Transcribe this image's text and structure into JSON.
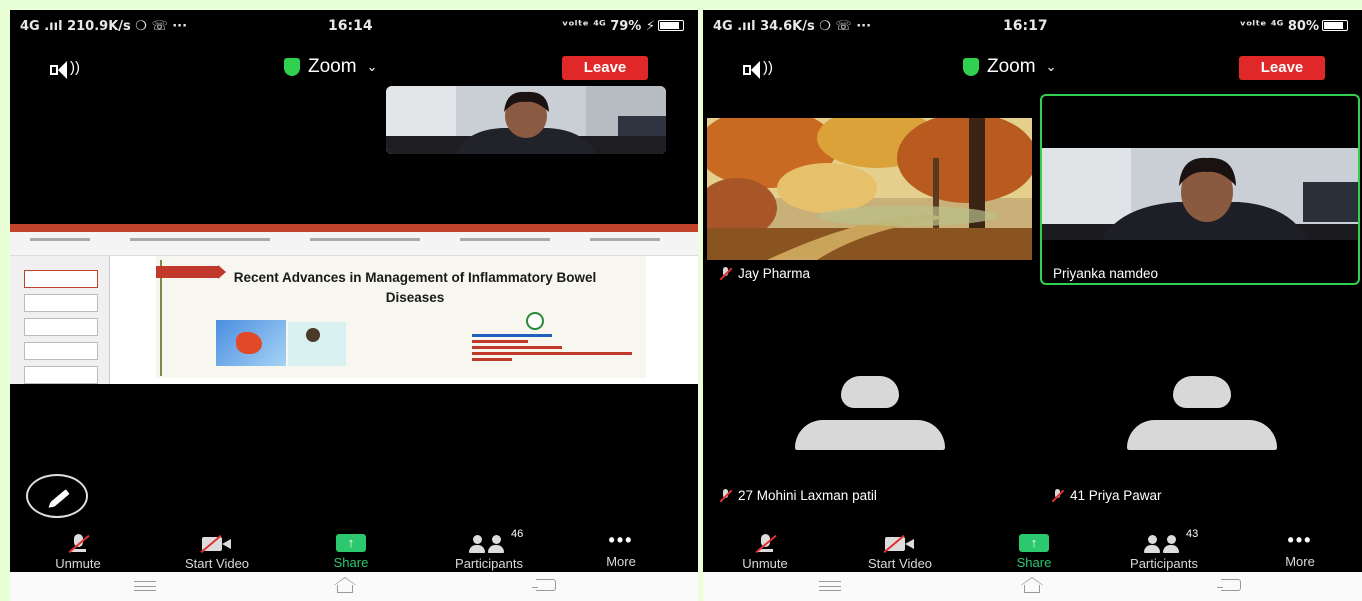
{
  "phones": [
    {
      "status": {
        "network": "4G .ııl 210.9K/s ❍ ☏ ···",
        "time": "16:14",
        "right": "ᵛᵒˡᵗᵉ ⁴ᴳ 79% ⚡"
      },
      "meeting_title": "Zoom",
      "leave_label": "Leave",
      "slide": {
        "title": "Recent Advances in Management of Inflammatory Bowel Diseases"
      },
      "toolbar": {
        "unmute": "Unmute",
        "start_video": "Start Video",
        "share": "Share",
        "participants": "Participants",
        "participants_count": "46",
        "more": "More"
      }
    },
    {
      "status": {
        "network": "4G .ııl 34.6K/s ❍ ☏ ···",
        "time": "16:17",
        "right": "ᵛᵒˡᵗᵉ ⁴ᴳ 80%"
      },
      "meeting_title": "Zoom",
      "leave_label": "Leave",
      "tiles": [
        {
          "name": "Jay Pharma"
        },
        {
          "name": "Priyanka namdeo"
        },
        {
          "name": "27 Mohini Laxman patil"
        },
        {
          "name": "41 Priya Pawar"
        }
      ],
      "toolbar": {
        "unmute": "Unmute",
        "start_video": "Start Video",
        "share": "Share",
        "participants": "Participants",
        "participants_count": "43",
        "more": "More"
      }
    }
  ],
  "colors": {
    "share_green": "#2cc86e",
    "leave_red": "#e02828",
    "active_speaker": "#2fd14f",
    "page_bg": "#e8ffd8"
  }
}
